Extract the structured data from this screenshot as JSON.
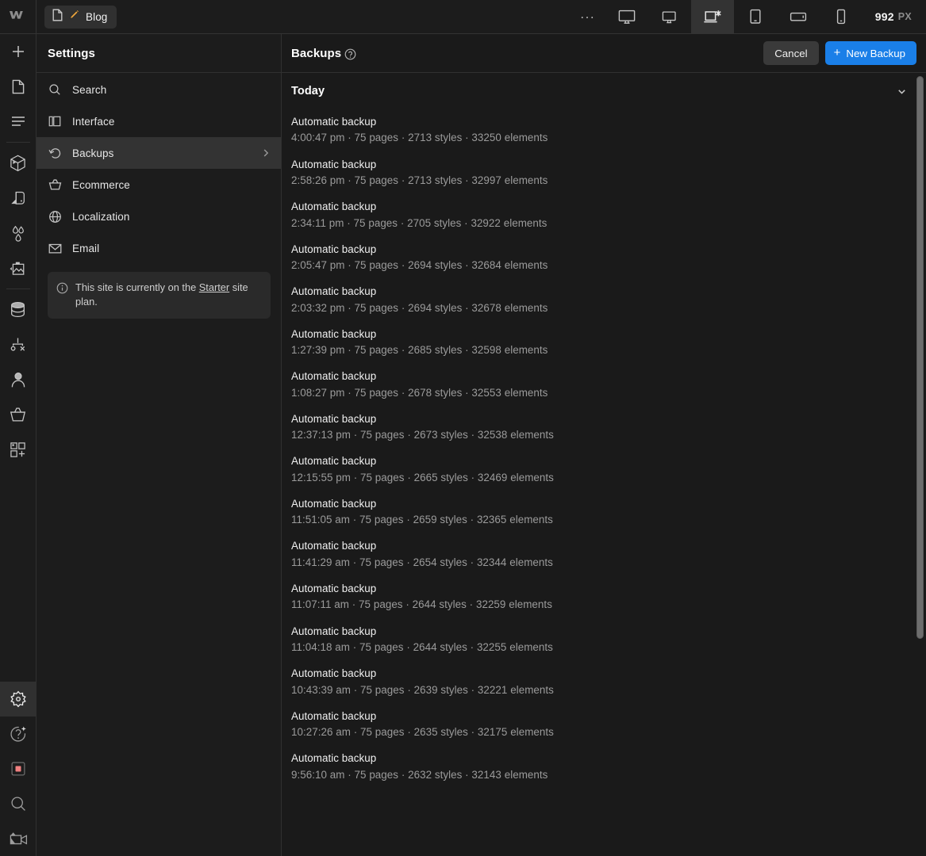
{
  "topbar": {
    "logo_name": "webflow-logo",
    "tab": {
      "label": "Blog",
      "page_icon": "page-icon",
      "pencil_icon": "pencil-icon"
    },
    "overflow_label": "...",
    "devices": [
      {
        "name": "desktop-large",
        "active": false
      },
      {
        "name": "desktop",
        "active": false
      },
      {
        "name": "desktop-base",
        "active": true
      },
      {
        "name": "tablet",
        "active": false
      },
      {
        "name": "mobile-landscape",
        "active": false
      },
      {
        "name": "mobile-portrait",
        "active": false
      }
    ],
    "viewport_width": "992",
    "viewport_unit": "PX"
  },
  "rail": {
    "top_items": [
      {
        "name": "add-element",
        "icon": "plus-icon"
      },
      {
        "name": "pages",
        "icon": "page-icon"
      },
      {
        "name": "navigator",
        "icon": "navigator-icon"
      }
    ],
    "mid_items": [
      {
        "name": "components",
        "icon": "cube-icon"
      },
      {
        "name": "style-selector",
        "icon": "style-icon"
      },
      {
        "name": "variables",
        "icon": "droplets-icon"
      },
      {
        "name": "assets",
        "icon": "image-icon"
      }
    ],
    "data_items": [
      {
        "name": "cms",
        "icon": "database-icon"
      },
      {
        "name": "logic",
        "icon": "logic-icon"
      },
      {
        "name": "users",
        "icon": "user-icon"
      },
      {
        "name": "ecommerce",
        "icon": "basket-icon"
      },
      {
        "name": "apps",
        "icon": "apps-icon"
      }
    ],
    "bottom_items": [
      {
        "name": "settings",
        "icon": "gear-icon",
        "active": true
      },
      {
        "name": "help-ai",
        "icon": "question-sparkle-icon",
        "active": false
      },
      {
        "name": "recording",
        "icon": "stop-record-icon",
        "active": false
      },
      {
        "name": "search",
        "icon": "search-icon",
        "active": false
      },
      {
        "name": "video",
        "icon": "video-camera-icon",
        "active": false
      }
    ]
  },
  "settings": {
    "title": "Settings",
    "items": [
      {
        "label": "Search",
        "icon": "search-icon",
        "active": false,
        "chevron": false
      },
      {
        "label": "Interface",
        "icon": "panels-icon",
        "active": false,
        "chevron": false
      },
      {
        "label": "Backups",
        "icon": "restore-icon",
        "active": true,
        "chevron": true
      },
      {
        "label": "Ecommerce",
        "icon": "basket-icon",
        "active": false,
        "chevron": false
      },
      {
        "label": "Localization",
        "icon": "globe-icon",
        "active": false,
        "chevron": false
      },
      {
        "label": "Email",
        "icon": "envelope-icon",
        "active": false,
        "chevron": false
      }
    ],
    "plan_notice": {
      "icon": "info-icon",
      "text_before": "This site is currently on the ",
      "link": "Starter",
      "text_after": " site plan."
    }
  },
  "main": {
    "title": "Backups",
    "help_icon": "question-circle-icon",
    "cancel_label": "Cancel",
    "new_backup_label": "New Backup",
    "new_backup_plus": "+",
    "group": {
      "title": "Today",
      "chevron_icon": "chevron-down-icon"
    },
    "backups": [
      {
        "name": "Automatic backup",
        "meta": "4:00:47 pm · 75 pages · 2713 styles · 33250 elements"
      },
      {
        "name": "Automatic backup",
        "meta": "2:58:26 pm · 75 pages · 2713 styles · 32997 elements"
      },
      {
        "name": "Automatic backup",
        "meta": "2:34:11 pm · 75 pages · 2705 styles · 32922 elements"
      },
      {
        "name": "Automatic backup",
        "meta": "2:05:47 pm · 75 pages · 2694 styles · 32684 elements"
      },
      {
        "name": "Automatic backup",
        "meta": "2:03:32 pm · 75 pages · 2694 styles · 32678 elements"
      },
      {
        "name": "Automatic backup",
        "meta": "1:27:39 pm · 75 pages · 2685 styles · 32598 elements"
      },
      {
        "name": "Automatic backup",
        "meta": "1:08:27 pm · 75 pages · 2678 styles · 32553 elements"
      },
      {
        "name": "Automatic backup",
        "meta": "12:37:13 pm · 75 pages · 2673 styles · 32538 elements"
      },
      {
        "name": "Automatic backup",
        "meta": "12:15:55 pm · 75 pages · 2665 styles · 32469 elements"
      },
      {
        "name": "Automatic backup",
        "meta": "11:51:05 am · 75 pages · 2659 styles · 32365 elements"
      },
      {
        "name": "Automatic backup",
        "meta": "11:41:29 am · 75 pages · 2654 styles · 32344 elements"
      },
      {
        "name": "Automatic backup",
        "meta": "11:07:11 am · 75 pages · 2644 styles · 32259 elements"
      },
      {
        "name": "Automatic backup",
        "meta": "11:04:18 am · 75 pages · 2644 styles · 32255 elements"
      },
      {
        "name": "Automatic backup",
        "meta": "10:43:39 am · 75 pages · 2639 styles · 32221 elements"
      },
      {
        "name": "Automatic backup",
        "meta": "10:27:26 am · 75 pages · 2635 styles · 32175 elements"
      },
      {
        "name": "Automatic backup",
        "meta": "9:56:10 am · 75 pages · 2632 styles · 32143 elements"
      }
    ]
  },
  "colors": {
    "accent_blue": "#1a7fe8",
    "panel_bg": "#1c1c1c",
    "main_bg": "#1a1a1a",
    "active_row": "#333333",
    "record_red": "#f08080",
    "pencil_orange": "#e8a33d"
  }
}
